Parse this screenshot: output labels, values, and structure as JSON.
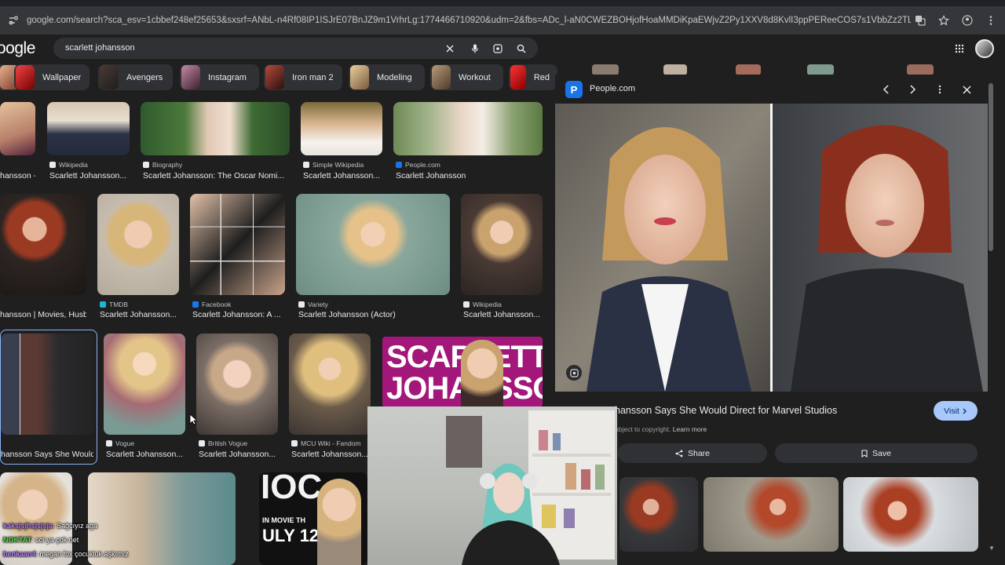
{
  "browser": {
    "url": "google.com/search?sca_esv=1cbbef248ef25653&sxsrf=ANbL-n4Rf08IP1ISJrE07BnJZ9m1VrhrLg:1774466710920&udm=2&fbs=ADc_l-aN0CWEZBOHjofHoaMMDiKpaEWjvZ2Py1XXV8d8KvlI3ppPEReeCOS7s1VbbZz2TLsHwpSX8VU1h5wlQRdyYz8mXESeuAdmyYS..."
  },
  "header": {
    "logo": "oogle",
    "search_query": "scarlett johansson",
    "icons": [
      "clear-icon",
      "mic-icon",
      "lens-icon",
      "search-icon",
      "apps-icon"
    ]
  },
  "chips": [
    {
      "label": "Wallpaper"
    },
    {
      "label": "Avengers"
    },
    {
      "label": "Instagram"
    },
    {
      "label": "Iron man 2"
    },
    {
      "label": "Modeling"
    },
    {
      "label": "Workout"
    },
    {
      "label": "Red"
    }
  ],
  "results": [
    {
      "source": "",
      "title": "hansson - ..."
    },
    {
      "source": "Wikipedia",
      "title": "Scarlett Johansson..."
    },
    {
      "source": "Biography",
      "title": "Scarlett Johansson: The Oscar Nomi..."
    },
    {
      "source": "Simple Wikipedia",
      "title": "Scarlett Johansson..."
    },
    {
      "source": "People.com",
      "title": "Scarlett Johansson"
    },
    {
      "source": "",
      "title": "hansson | Movies, Husb..."
    },
    {
      "source": "TMDB",
      "title": "Scarlett Johansson..."
    },
    {
      "source": "Facebook",
      "title": "Scarlett Johansson: A ..."
    },
    {
      "source": "Variety",
      "title": "Scarlett Johansson (Actor)"
    },
    {
      "source": "Wikipedia",
      "title": "Scarlett Johansson..."
    },
    {
      "source": "",
      "title": "hansson Says She Would ..."
    },
    {
      "source": "Vogue",
      "title": "Scarlett Johansson..."
    },
    {
      "source": "British Vogue",
      "title": "Scarlett Johansson..."
    },
    {
      "source": "MCU Wiki - Fandom",
      "title": "Scarlett Johansson..."
    },
    {
      "source": "",
      "title": ""
    }
  ],
  "magazine_cover_text": [
    "SCARLETT",
    "JOHANSSON"
  ],
  "bottom_poster_text": [
    "IOC",
    "IN MOVIE TH",
    "ULY 12"
  ],
  "panel": {
    "site_letter": "P",
    "site": "People.com",
    "title": "hansson Says She Would Direct for Marvel Studios",
    "visit": "Visit",
    "copyright": "ubject to copyright.",
    "learn_more": "Learn more",
    "share": "Share",
    "save": "Save"
  },
  "chat": [
    {
      "user": "kaksjsjhsjsjsja",
      "color": "#b884ff",
      "message": "Sağcıyız aga"
    },
    {
      "user": "NOKTAT",
      "color": "#57e04a",
      "message": "sol ya çok net"
    },
    {
      "user": "benkaan4",
      "color": "#b884ff",
      "message": "megan fox çocukluk aşkımız"
    }
  ]
}
